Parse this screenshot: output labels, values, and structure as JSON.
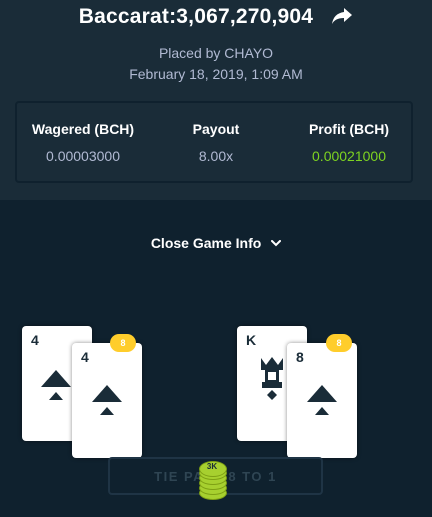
{
  "header": {
    "title": "Baccarat:3,067,270,904",
    "placed_by": "Placed by CHAYO",
    "date": "February 18, 2019, 1:09 AM"
  },
  "stats": {
    "wagered_label": "Wagered (BCH)",
    "wagered_value": "0.00003000",
    "payout_label": "Payout",
    "payout_value": "8.00x",
    "profit_label": "Profit (BCH)",
    "profit_value": "0.00021000"
  },
  "toggle": {
    "label": "Close Game Info"
  },
  "player_hand": {
    "cards": [
      {
        "rank": "4",
        "suit": "spades"
      },
      {
        "rank": "4",
        "suit": "spades"
      }
    ],
    "score": "8"
  },
  "banker_hand": {
    "cards": [
      {
        "rank": "K",
        "suit": "diamonds"
      },
      {
        "rank": "8",
        "suit": "spades"
      }
    ],
    "score": "8"
  },
  "tie": {
    "label": "TIE PAYS 8 TO 1",
    "chip_label": "3K"
  },
  "colors": {
    "background": "#0f212e",
    "panel": "#1a2c38",
    "profit_green": "#7ed321",
    "badge_yellow": "#ffcd2b",
    "chip_green": "#a7d02f"
  },
  "icons": [
    "share-icon",
    "chevron-down-icon",
    "spade-icon",
    "diamond-icon",
    "king-icon"
  ]
}
